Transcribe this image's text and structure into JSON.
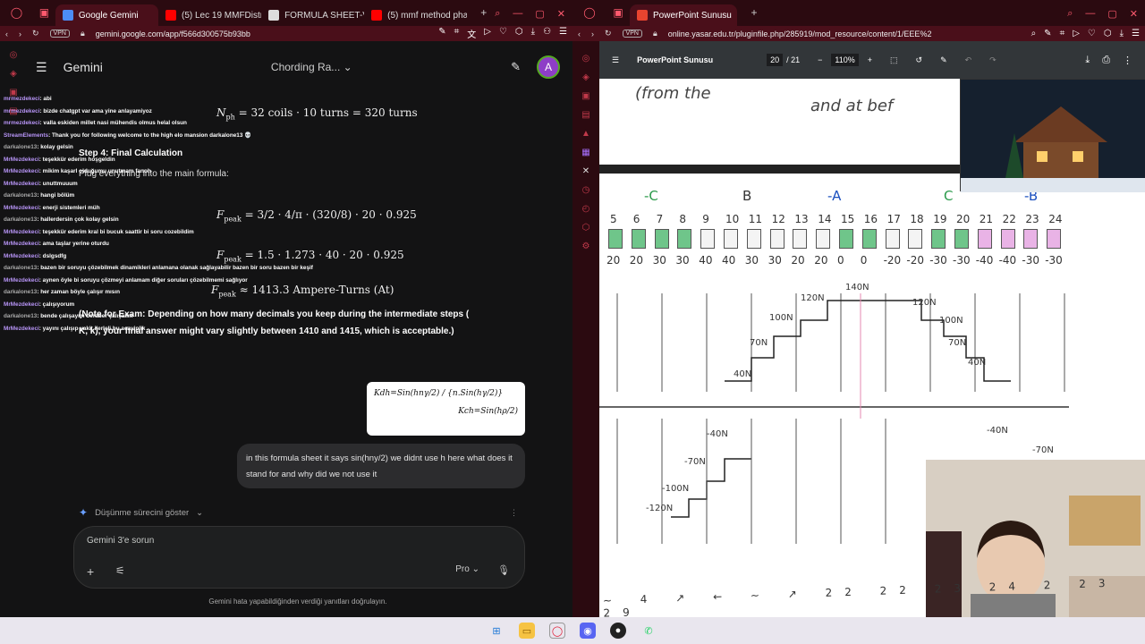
{
  "left_browser": {
    "tabs": [
      {
        "label": "Google Gemini",
        "active": true
      },
      {
        "label": "(5) Lec 19 MMFDistrib",
        "active": false
      },
      {
        "label": "FORMULA SHEET-VE",
        "active": false
      },
      {
        "label": "(5) mmf method phas",
        "active": false
      }
    ],
    "url": "gemini.google.com/app/f566d300575b93bb",
    "vpn_label": "VPN"
  },
  "gemini": {
    "title": "Gemini",
    "model_label": "Chording Ra...",
    "avatar_letter": "A",
    "math": {
      "nph": "N",
      "nph_sub": "ph",
      "nph_eq": "= 32 coils · 10 turns = 320 turns",
      "fpeak_eq1": "= 3/2 · 4/π · (320/8) · 20 · 0.925",
      "fpeak_eq2": "= 1.5 · 1.273 · 40 · 20 · 0.925",
      "fpeak_result": "≈ 1413.3 Ampere-Turns (At)",
      "fpeak_label": "F",
      "fpeak_sub": "peak"
    },
    "step_heading": "Step 4: Final Calculation",
    "step_text": "Plug everything into the main formula:",
    "note_line1": "(Note for Exam: Depending on how many decimals you keep during the intermediate steps (",
    "note_line2": "K, k), your final answer might vary slightly between 1410 and 1415, which is acceptable.)",
    "formula_card_line1": "Kdh=Sin(hnγ/2) / {n.Sin(hγ/2)}",
    "formula_card_line2": "Kch=Sin(hρ/2)",
    "user_message": "in this formula sheet it says sin(hny/2) we didnt use h here what does it stand for and why did we not use it",
    "thinking_label": "Düşünme sürecini göster",
    "input_placeholder": "Gemini 3'e sorun",
    "mode_label": "Pro",
    "footer_note": "Gemini hata yapabildiğinden verdiği yanıtları doğrulayın."
  },
  "chat_overlay": [
    {
      "user": "mrmezdekeci",
      "text": "abi"
    },
    {
      "user": "mrmezdekeci",
      "text": "bizde chatgpt var ama yine anlayamiyoz"
    },
    {
      "user": "mrmezdekeci",
      "text": "valla eskiden millet nasi mühendis olmus helal olsun"
    },
    {
      "user": "StreamElements",
      "text": "Thank you for following welcome to the high elo mansion darkalone13 💀"
    },
    {
      "user": "darkalone13",
      "text": "kolay gelsin"
    },
    {
      "user": "MrMezdekeci",
      "text": "teşekkür ederim hoşgeldin"
    },
    {
      "user": "MrMezdekeci",
      "text": "mikim kaşarl olduğumu unutmam fanoh"
    },
    {
      "user": "MrMezdekeci",
      "text": "unuttmuuum"
    },
    {
      "user": "darkalone13",
      "text": "hangi bölüm"
    },
    {
      "user": "MrMezdekeci",
      "text": "enerji sistemleri müh"
    },
    {
      "user": "darkalone13",
      "text": "hallerdersin çok kolay gelsin"
    },
    {
      "user": "MrMezdekeci",
      "text": "teşekkür ederim kral bi bucuk saattir bi soru cozebildim"
    },
    {
      "user": "MrMezdekeci",
      "text": "ama taşlar yerine oturdu"
    },
    {
      "user": "MrMezdekeci",
      "text": "dslgsdfg"
    },
    {
      "user": "darkalone13",
      "text": "bazen bir soruyu çözebilmek dinamikleri anlamana olanak sağlayabilir bazen bir soru bazen bir keşif"
    },
    {
      "user": "MrMezdekeci",
      "text": "aynen öyle bi soruyu çözmeyi anlamam diğer soruları çözebilmemi sağlıyor"
    },
    {
      "user": "darkalone13",
      "text": "her zaman böyle çalışır mısın"
    },
    {
      "user": "MrMezdekeci",
      "text": "çalışıyorum"
    },
    {
      "user": "darkalone13",
      "text": "bende çalışayım beraber çalışalım"
    },
    {
      "user": "MrMezdekeci",
      "text": "yayını çalışıp vakit ilerleli bu acayiplik"
    }
  ],
  "right_browser": {
    "tabs": [
      {
        "label": "PowerPoint Sunusu",
        "active": true
      }
    ],
    "url": "online.yasar.edu.tr/pluginfile.php/285919/mod_resource/content/1/EEE%2",
    "vpn_label": "VPN"
  },
  "pdf_viewer": {
    "title": "PowerPoint Sunusu",
    "current_page": "20",
    "total_pages": "/ 21",
    "zoom": "110%",
    "slot_numbers": [
      "5",
      "6",
      "7",
      "8",
      "9",
      "10",
      "11",
      "12",
      "13",
      "14",
      "15",
      "16",
      "17",
      "18",
      "19",
      "20",
      "21",
      "22",
      "23",
      "24"
    ],
    "mmf_values": [
      "20",
      "20",
      "30",
      "30",
      "40",
      "40",
      "30",
      "30",
      "20",
      "20",
      "0",
      "0",
      "-20",
      "-20",
      "-30",
      "-30",
      "-40",
      "-40",
      "-30",
      "-30"
    ],
    "group_labels": [
      "-C",
      "B",
      "-A",
      "C",
      "-B"
    ],
    "step_labels": [
      "40N",
      "70N",
      "100N",
      "120N",
      "140N",
      "120N",
      "100N",
      "70N",
      "40N",
      "-40N",
      "-70N",
      "-100N",
      "-120N",
      "-40N",
      "-70N"
    ]
  },
  "taskbar": {
    "icons": [
      "windows-icon",
      "file-explorer-icon",
      "opera-icon",
      "discord-icon",
      "obs-icon",
      "whatsapp-icon"
    ]
  }
}
